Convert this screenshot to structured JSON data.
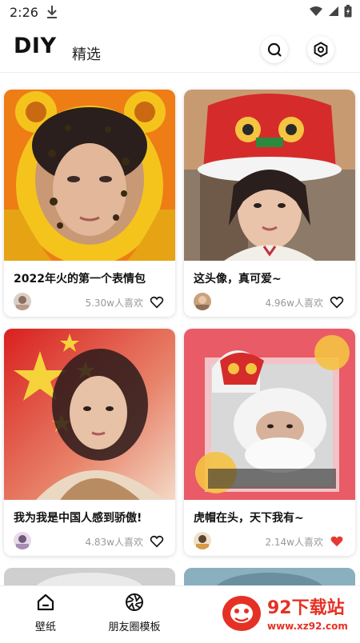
{
  "status": {
    "time": "2:26"
  },
  "header": {
    "title": "DIY",
    "tab": "精选"
  },
  "cards": [
    {
      "title": "2022年火的第一个表情包",
      "likes": "5.30w人喜欢",
      "liked": false
    },
    {
      "title": "这头像，真可爱~",
      "likes": "4.96w人喜欢",
      "liked": false
    },
    {
      "title": "我为我是中国人感到骄傲!",
      "likes": "4.83w人喜欢",
      "liked": false
    },
    {
      "title": "虎帽在头，天下我有~",
      "likes": "2.14w人喜欢",
      "liked": true
    }
  ],
  "nav": {
    "items": [
      {
        "label": "壁纸",
        "icon": "home-icon"
      },
      {
        "label": "朋友圈模板",
        "icon": "aperture-icon"
      }
    ]
  },
  "watermark": {
    "name": "92下载站",
    "url": "www.xz92.com"
  },
  "colors": {
    "liked": "#e53935",
    "muted": "#999999"
  }
}
